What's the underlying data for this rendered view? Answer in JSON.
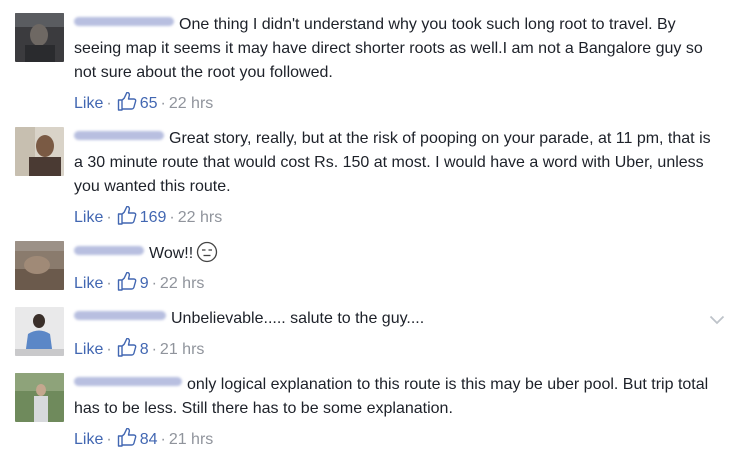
{
  "comments": [
    {
      "text": "One thing I didn't understand why you took such long root to travel. By seeing map it seems it may have direct shorter roots as well.I am not a Bangalore guy so not sure about the root you followed.",
      "like_label": "Like",
      "like_count": "65",
      "time": "22 hrs",
      "avatar_icon": "blurred-profile-photo"
    },
    {
      "text": "Great story, really, but at the risk of pooping on your parade, at 11 pm, that is a 30 minute route that would cost Rs. 150 at most. I would have a word with Uber, unless you wanted this route.",
      "like_label": "Like",
      "like_count": "169",
      "time": "22 hrs",
      "avatar_icon": "blurred-profile-photo"
    },
    {
      "text": "Wow!!",
      "like_label": "Like",
      "like_count": "9",
      "time": "22 hrs",
      "avatar_icon": "blurred-profile-photo",
      "emoji_icon": "expressionless-face-icon"
    },
    {
      "text": "Unbelievable..... salute to the guy....",
      "like_label": "Like",
      "like_count": "8",
      "time": "21 hrs",
      "avatar_icon": "blurred-profile-photo",
      "menu_icon": "chevron-down-icon"
    },
    {
      "text": "only logical explanation to this route is this may be uber pool. But trip total has to be less. Still there has to be some explanation.",
      "like_label": "Like",
      "like_count": "84",
      "time": "21 hrs",
      "avatar_icon": "blurred-profile-photo"
    }
  ],
  "separator": "·",
  "colors": {
    "link": "#4267b2",
    "meta": "#90949c",
    "name_blur": "#b8bfe0",
    "text": "#1d2129"
  }
}
